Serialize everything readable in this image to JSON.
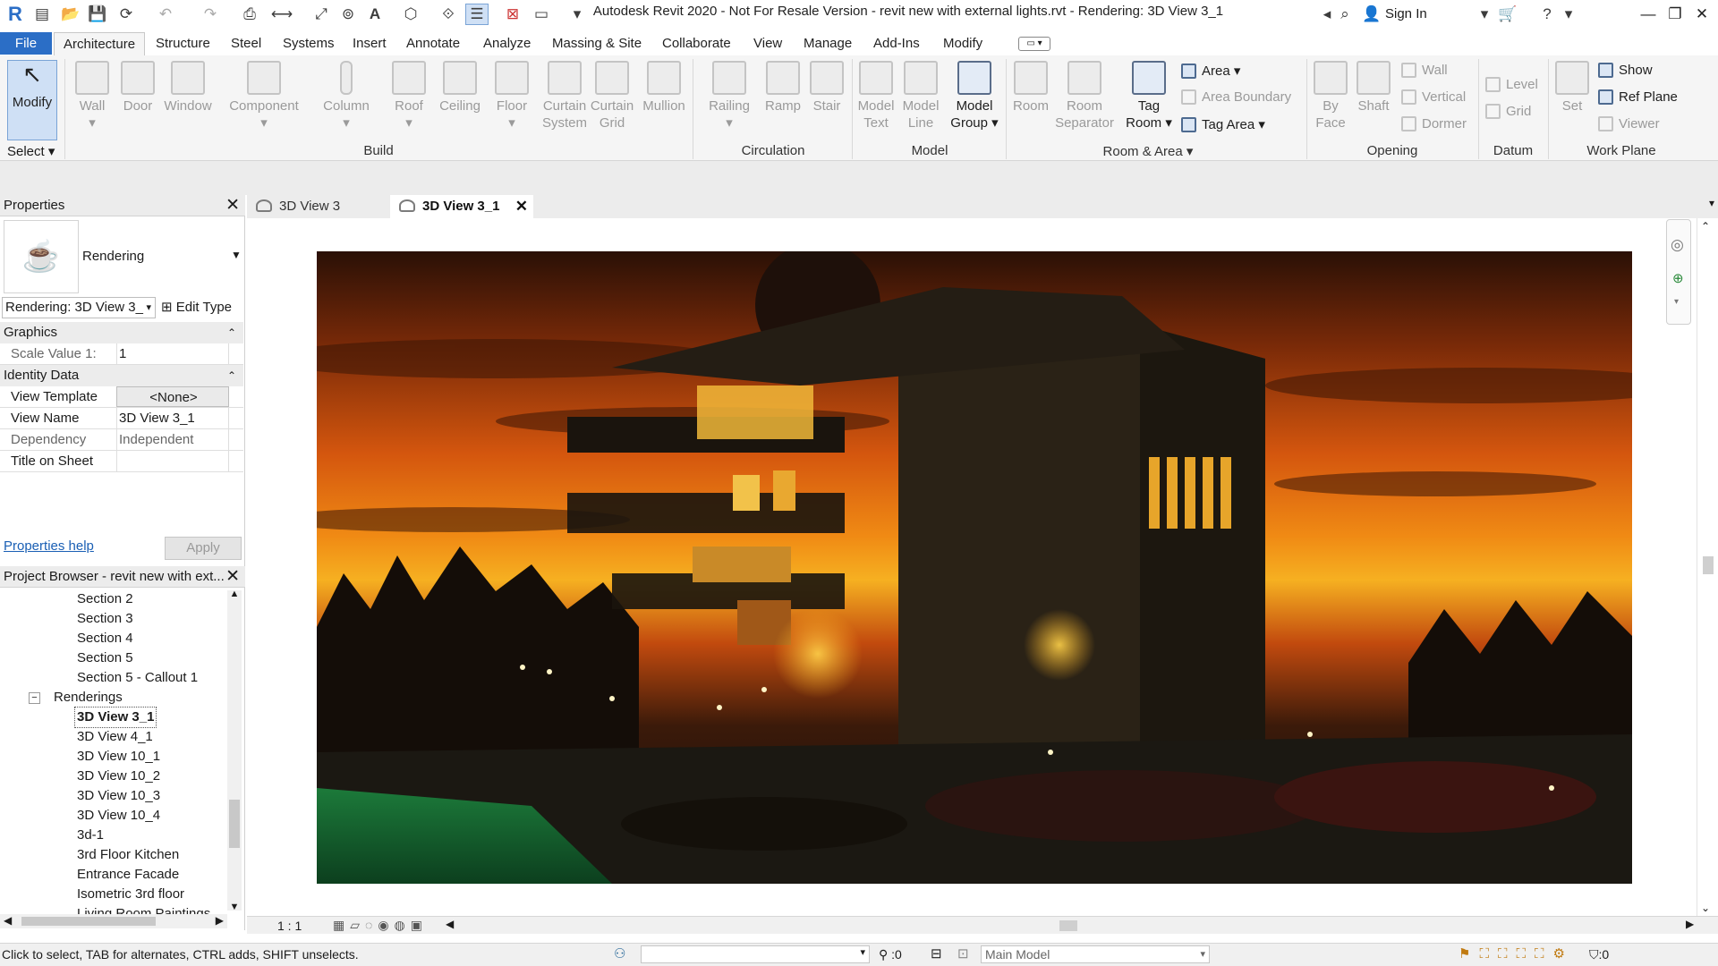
{
  "app": {
    "title": "Autodesk Revit 2020 - Not For Resale Version - revit new with external lights.rvt - Rendering: 3D View 3_1",
    "sign_in": "Sign In"
  },
  "menu": {
    "file": "File",
    "tabs": [
      "Architecture",
      "Structure",
      "Steel",
      "Systems",
      "Insert",
      "Annotate",
      "Analyze",
      "Massing & Site",
      "Collaborate",
      "View",
      "Manage",
      "Add-Ins",
      "Modify"
    ]
  },
  "ribbon": {
    "select": {
      "modify": "Modify",
      "select_label": "Select"
    },
    "build": {
      "label": "Build",
      "wall": "Wall",
      "door": "Door",
      "window": "Window",
      "component": "Component",
      "column": "Column",
      "roof": "Roof",
      "ceiling": "Ceiling",
      "floor": "Floor",
      "curtain_system": "Curtain System",
      "curtain_grid": "Curtain Grid",
      "mullion": "Mullion"
    },
    "circulation": {
      "label": "Circulation",
      "railing": "Railing",
      "ramp": "Ramp",
      "stair": "Stair"
    },
    "model": {
      "label": "Model",
      "model_text": "Model Text",
      "model_line": "Model Line",
      "model_group": "Model Group"
    },
    "room_area": {
      "label": "Room & Area",
      "room": "Room",
      "room_separator": "Room Separator",
      "tag_room": "Tag Room",
      "area": "Area",
      "area_boundary": "Area  Boundary",
      "tag_area": "Tag  Area"
    },
    "opening": {
      "label": "Opening",
      "by_face": "By Face",
      "shaft": "Shaft",
      "wall": "Wall",
      "vertical": "Vertical",
      "dormer": "Dormer"
    },
    "datum": {
      "label": "Datum",
      "level": "Level",
      "grid": "Grid"
    },
    "work_plane": {
      "label": "Work Plane",
      "set": "Set",
      "show": "Show",
      "ref_plane": "Ref  Plane",
      "viewer": "Viewer"
    }
  },
  "properties": {
    "title": "Properties",
    "type_name": "Rendering",
    "selector": "Rendering: 3D View 3_",
    "edit_type": "Edit Type",
    "groups": {
      "graphics": "Graphics",
      "identity": "Identity Data"
    },
    "rows": {
      "scale_key": "Scale Value    1:",
      "scale_val": "1",
      "template_key": "View Template",
      "template_val": "<None>",
      "viewname_key": "View Name",
      "viewname_val": "3D View 3_1",
      "dependency_key": "Dependency",
      "dependency_val": "Independent",
      "sheet_key": "Title on Sheet",
      "sheet_val": ""
    },
    "help": "Properties help",
    "apply": "Apply"
  },
  "browser": {
    "title": "Project Browser - revit new with ext...",
    "items": [
      "Section 2",
      "Section 3",
      "Section 4",
      "Section 5",
      "Section 5 - Callout 1"
    ],
    "group": "Renderings",
    "renderings": [
      "3D View 3_1",
      "3D View 4_1",
      "3D View 10_1",
      "3D View 10_2",
      "3D View 10_3",
      "3D View 10_4",
      "3d-1",
      "3rd Floor Kitchen",
      "Entrance Facade",
      "Isometric 3rd floor",
      "Living Room Paintings"
    ]
  },
  "view_tabs": [
    "3D View 3",
    "3D View 3_1"
  ],
  "view_control": {
    "scale": "1 : 1"
  },
  "status": {
    "hint": "Click to select, TAB for alternates, CTRL adds, SHIFT unselects.",
    "worksets": "0",
    "model": "Main Model",
    "filter": "0"
  },
  "colors": {
    "file_tab": "#2b6ec6",
    "sky_top": "#3a1808",
    "sky_mid": "#e46a12",
    "sky_glow": "#f6b021"
  }
}
